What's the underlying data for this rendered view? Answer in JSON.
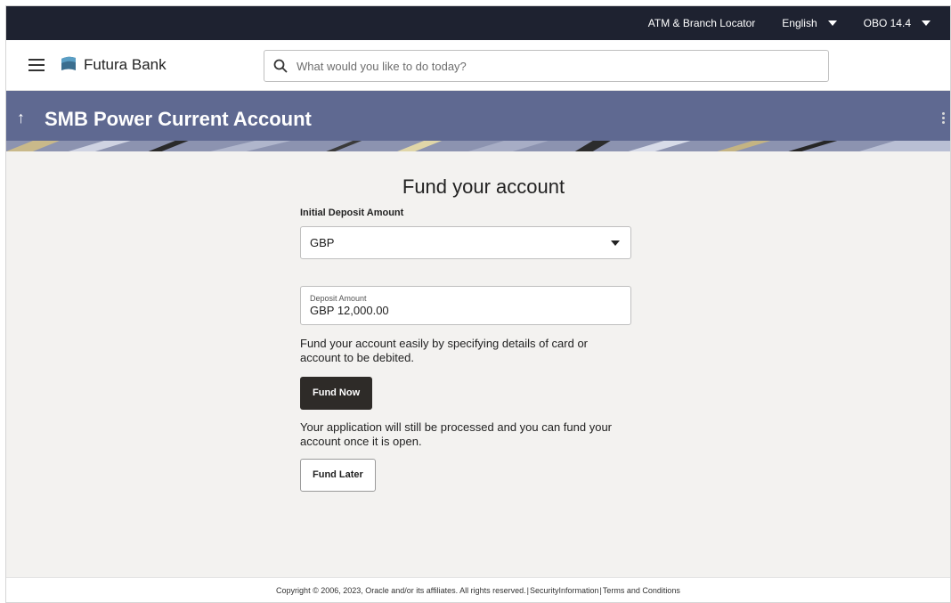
{
  "topbar": {
    "locator": "ATM & Branch Locator",
    "language": "English",
    "user": "OBO 14.4"
  },
  "header": {
    "brand": "Futura Bank",
    "search_placeholder": "What would you like to do today?"
  },
  "banner": {
    "title": "SMB Power Current Account"
  },
  "form": {
    "page_title": "Fund your account",
    "initial_deposit_label": "Initial Deposit Amount",
    "currency_selected": "GBP",
    "deposit_amount_label": "Deposit Amount",
    "deposit_amount_value": "GBP 12,000.00",
    "fund_now_text": "Fund your account easily by specifying details of card or account to be debited.",
    "fund_now_button": "Fund Now",
    "fund_later_text": "Your application will still be processed and you can fund your account once it is open.",
    "fund_later_button": "Fund Later"
  },
  "footer": {
    "copyright": "Copyright © 2006, 2023, Oracle and/or its affiliates. All rights reserved.",
    "security": "SecurityInformation",
    "terms": "Terms and Conditions"
  },
  "colors": {
    "topbar": "#1e2230",
    "banner": "#5f6991",
    "primary_button": "#2e2b28",
    "page_background": "#f3f2f0"
  }
}
